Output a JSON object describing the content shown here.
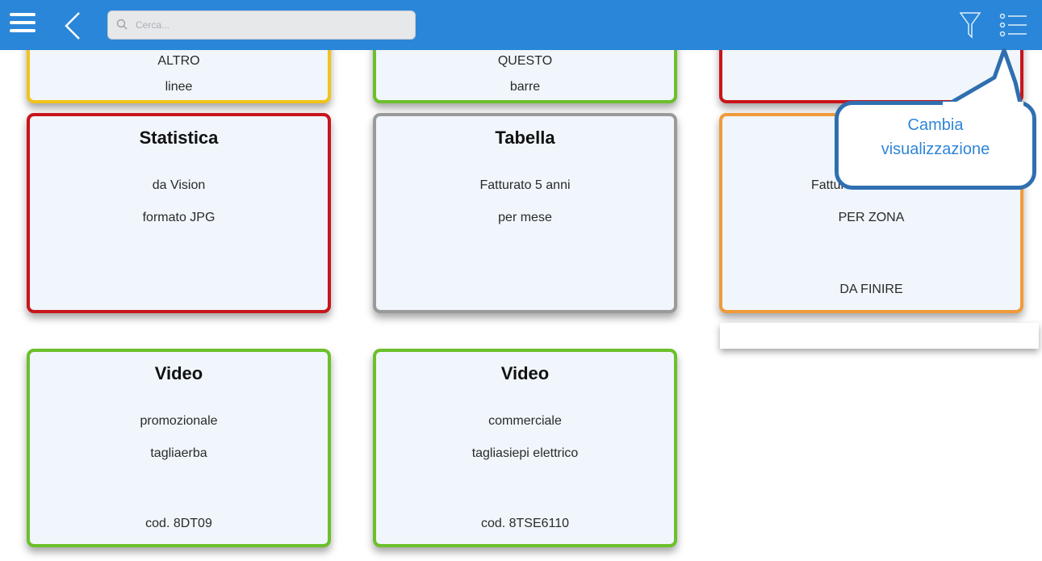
{
  "search": {
    "placeholder": "Cerca..."
  },
  "callout": {
    "line1": "Cambia",
    "line2": "visualizzazione"
  },
  "cards_top_partial": [
    {
      "color": "#f2c31a",
      "line1": "ALTRO",
      "line2": "linee"
    },
    {
      "color": "#6cc02a",
      "line1": "QUESTO",
      "line2": "barre"
    },
    {
      "color": "#c8151b",
      "line1": "",
      "line2": ""
    }
  ],
  "cards_row2": [
    {
      "color": "#c8151b",
      "title": "Statistica",
      "line1": "da Vision",
      "line2": "formato JPG",
      "footer": ""
    },
    {
      "color": "#9a9a9a",
      "title": "Tabella",
      "line1": "Fatturato 5 anni",
      "line2": "per mese",
      "footer": ""
    },
    {
      "color": "#f09a3a",
      "title": "",
      "line1": "Fatturato",
      "line2": "PER ZONA",
      "footer": "DA FINIRE"
    }
  ],
  "cards_row3": [
    {
      "color": "#6cc02a",
      "title": "Video",
      "line1": "promozionale",
      "line2": "tagliaerba",
      "footer": "cod. 8DT09"
    },
    {
      "color": "#6cc02a",
      "title": "Video",
      "line1": "commerciale",
      "line2": "tagliasiepi elettrico",
      "footer": "cod. 8TSE6110"
    }
  ],
  "icons": {
    "menu": "hamburger-menu-icon",
    "back": "chevron-left-icon",
    "search": "search-icon",
    "filter": "filter-icon",
    "list": "list-view-icon"
  },
  "colors": {
    "topbar": "#2a86d8",
    "callout_border": "#2f6fb0",
    "callout_text": "#2f86d8"
  }
}
